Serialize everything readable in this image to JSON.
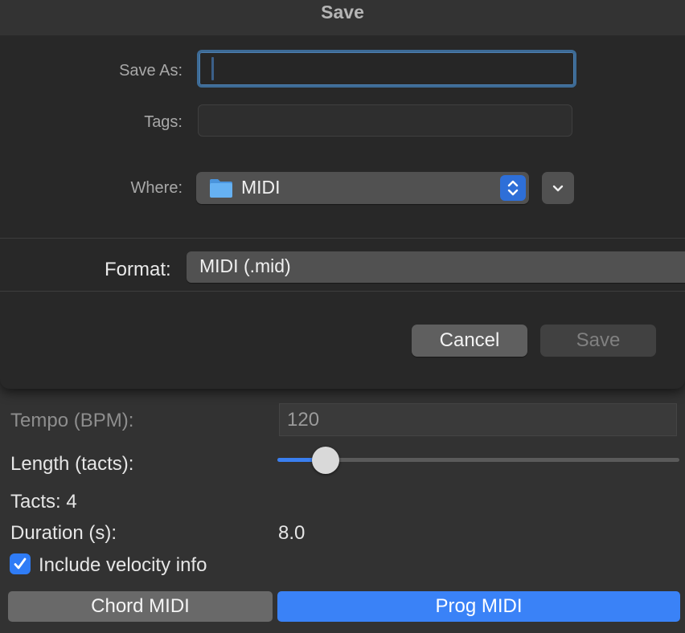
{
  "dialog": {
    "title": "Save",
    "save_as_label": "Save As:",
    "save_as_value": "",
    "tags_label": "Tags:",
    "tags_value": "",
    "where_label": "Where:",
    "where_value": "MIDI",
    "format_label": "Format:",
    "format_value": "MIDI (.mid)",
    "cancel_label": "Cancel",
    "save_label": "Save",
    "save_enabled": false
  },
  "panel": {
    "tempo_label": "Tempo (BPM):",
    "tempo_value": "120",
    "length_label": "Length (tacts):",
    "length_slider_fraction": 0.12,
    "tacts_text": "Tacts: 4",
    "duration_label": "Duration (s):",
    "duration_value": "8.0",
    "velocity_label": "Include velocity info",
    "velocity_checked": true,
    "chord_button": "Chord MIDI",
    "prog_button": "Prog MIDI"
  },
  "colors": {
    "accent": "#3a82f7",
    "focus_ring": "#3d6b96",
    "folder": "#5eaaf0"
  },
  "icons": {
    "where_folder": "folder-icon",
    "where_stepper": "up-down-chevron-icon",
    "expand": "chevron-down-icon",
    "velocity_check": "checkmark-icon"
  }
}
